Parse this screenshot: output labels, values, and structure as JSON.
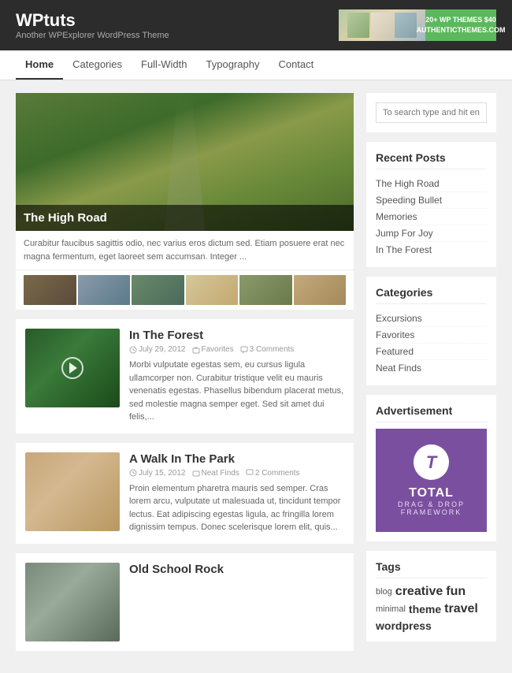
{
  "header": {
    "site_title": "WPtuts",
    "site_tagline": "Another WPExplorer WordPress Theme",
    "ad_cta": "20+ WP THEMES $40\nAUTHENTICTHEMES.COM"
  },
  "nav": {
    "items": [
      {
        "label": "Home",
        "active": true
      },
      {
        "label": "Categories",
        "active": false
      },
      {
        "label": "Full-Width",
        "active": false
      },
      {
        "label": "Typography",
        "active": false
      },
      {
        "label": "Contact",
        "active": false
      }
    ]
  },
  "featured": {
    "title": "The High Road",
    "excerpt": "Curabitur faucibus sagittis odio, nec varius eros dictum sed. Etiam posuere erat nec magna fermentum, eget laoreet sem accumsan. Integer ..."
  },
  "posts": [
    {
      "title": "In The Forest",
      "date": "July 29, 2012",
      "category": "Favorites",
      "comments": "3 Comments",
      "excerpt": "Morbi vulputate egestas sem, eu cursus ligula ullamcorper non. Curabitur tristique velit eu mauris venenatis egestas. Phasellus bibendum placerat metus, sed molestie magna semper eget. Sed sit amet dui felis,...",
      "has_play": true
    },
    {
      "title": "A Walk In The Park",
      "date": "July 15, 2012",
      "category": "Neat Finds",
      "comments": "2 Comments",
      "excerpt": "Proin elementum pharetra mauris sed semper. Cras lorem arcu, vulputate ut malesuada ut, tincidunt tempor lectus. Eat adipiscing egestas ligula, ac fringilla lorem dignissim tempus. Donec scelerisque lorem elit, quis...",
      "has_play": false
    },
    {
      "title": "Old School Rock",
      "date": "",
      "category": "",
      "comments": "",
      "excerpt": "",
      "has_play": false
    }
  ],
  "sidebar": {
    "search_placeholder": "To search type and hit enter",
    "recent_posts_title": "Recent Posts",
    "recent_posts": [
      {
        "label": "The High Road"
      },
      {
        "label": "Speeding Bullet"
      },
      {
        "label": "Memories"
      },
      {
        "label": "Jump For Joy"
      },
      {
        "label": "In The Forest"
      }
    ],
    "categories_title": "Categories",
    "categories": [
      {
        "label": "Excursions"
      },
      {
        "label": "Favorites"
      },
      {
        "label": "Featured"
      },
      {
        "label": "Neat Finds"
      }
    ],
    "ad_title": "Advertisement",
    "ad_logo_letter": "T",
    "ad_brand": "TOTAL",
    "ad_sub": "DRAG & DROP\nFRAMEWORK",
    "tags_title": "Tags",
    "tags": [
      {
        "label": "blog",
        "size": "small"
      },
      {
        "label": "creative",
        "size": "large"
      },
      {
        "label": "fun",
        "size": "large"
      },
      {
        "label": "minimal",
        "size": "small"
      },
      {
        "label": "theme",
        "size": "medium"
      },
      {
        "label": "travel",
        "size": "large"
      },
      {
        "label": "wordpress",
        "size": "medium"
      }
    ]
  }
}
